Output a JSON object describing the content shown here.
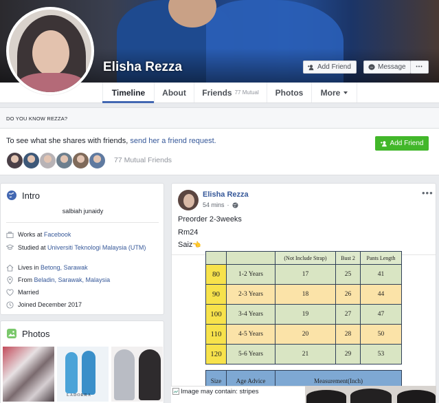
{
  "profile": {
    "name": "Elisha Rezza",
    "actions": {
      "add_friend": "Add Friend",
      "message": "Message",
      "more": "•••"
    }
  },
  "tabs": [
    {
      "label": "Timeline"
    },
    {
      "label": "About"
    },
    {
      "label": "Friends",
      "count": "77 Mutual"
    },
    {
      "label": "Photos"
    },
    {
      "label": "More"
    }
  ],
  "know": {
    "heading": "DO YOU KNOW REZZA?",
    "text": "To see what she shares with friends,",
    "link": "send her a friend request.",
    "button": "Add Friend",
    "mutual": "77 Mutual Friends",
    "face_colors": [
      "#4a3f46",
      "#3d5878",
      "#b8b3b6",
      "#6d7f8e",
      "#7f6a5a",
      "#5f7aa0"
    ]
  },
  "intro": {
    "title": "Intro",
    "bio": "salbiah junaidy",
    "items": [
      {
        "icon": "briefcase-icon",
        "prefix": "Works at",
        "link": "Facebook",
        "suffix": ""
      },
      {
        "icon": "graduation-cap-icon",
        "prefix": "Studied at",
        "link": "Universiti Teknologi Malaysia (UTM)",
        "suffix": ""
      },
      {
        "icon": "house-icon",
        "prefix": "Lives in",
        "link": "Betong, Sarawak",
        "suffix": ""
      },
      {
        "icon": "location-pin-icon",
        "prefix": "From",
        "link": "Beladin, Sarawak, Malaysia",
        "suffix": ""
      },
      {
        "icon": "heart-icon",
        "prefix": "Married",
        "link": "",
        "suffix": ""
      },
      {
        "icon": "clock-icon",
        "prefix": "Joined December 2017",
        "link": "",
        "suffix": ""
      }
    ]
  },
  "photos": {
    "title": "Photos",
    "caption": "LADORRA"
  },
  "post": {
    "author": "Elisha Rezza",
    "time": "54 mins",
    "lines": [
      "Preorder 2-3weeks",
      "Rm24",
      "Saiz"
    ],
    "pointing_emoji": "👈",
    "table1": {
      "headers": [
        "(Not Include Strap)",
        "Bust 2",
        "Pants Length"
      ],
      "rows": [
        [
          "80",
          "1-2 Years",
          "17",
          "25",
          "41"
        ],
        [
          "90",
          "2-3 Years",
          "18",
          "26",
          "44"
        ],
        [
          "100",
          "3-4 Years",
          "19",
          "27",
          "47"
        ],
        [
          "110",
          "4-5 Years",
          "20",
          "28",
          "50"
        ],
        [
          "120",
          "5-6 Years",
          "21",
          "29",
          "53"
        ]
      ]
    },
    "table2": {
      "size_header": "Size",
      "age_header": "Age Advice",
      "measure_header": "Measurement(Inch)"
    },
    "image_alt": "Image may contain: stripes"
  }
}
